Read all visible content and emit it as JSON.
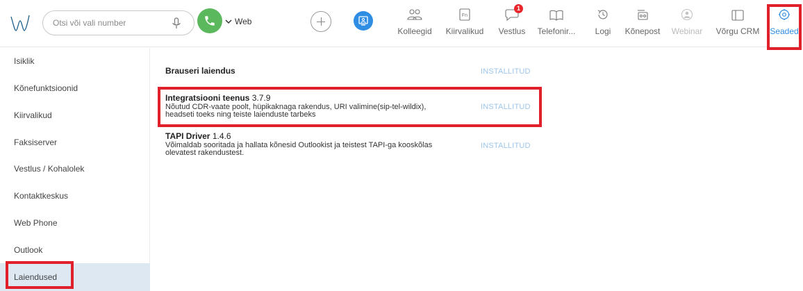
{
  "header": {
    "search_placeholder": "Otsi või vali number",
    "line_label": "Web",
    "nav": [
      {
        "label": "Kolleegid",
        "icon": "colleagues-icon"
      },
      {
        "label": "Kiirvalikud",
        "icon": "fn-key-icon"
      },
      {
        "label": "Vestlus",
        "icon": "chat-icon",
        "badge": "1"
      },
      {
        "label": "Telefonir...",
        "icon": "phonebook-icon"
      },
      {
        "label": "Logi",
        "icon": "history-icon"
      },
      {
        "label": "Kõnepost",
        "icon": "voicemail-icon"
      },
      {
        "label": "Webinar",
        "icon": "webinar-icon",
        "disabled": true
      },
      {
        "label": "Võrgu CRM",
        "icon": "crm-icon"
      },
      {
        "label": "Seaded",
        "icon": "settings-icon",
        "active": true
      }
    ]
  },
  "sidebar": {
    "items": [
      {
        "label": "Isiklik"
      },
      {
        "label": "Kõnefunktsioonid"
      },
      {
        "label": "Kiirvalikud"
      },
      {
        "label": "Faksiserver"
      },
      {
        "label": "Vestlus / Kohalolek"
      },
      {
        "label": "Kontaktkeskus"
      },
      {
        "label": "Web Phone"
      },
      {
        "label": "Outlook"
      },
      {
        "label": "Laiendused",
        "active": true
      }
    ]
  },
  "extensions": [
    {
      "name": "Brauseri laiendus",
      "version": "",
      "description": "",
      "status": "INSTALLITUD"
    },
    {
      "name": "Integratsiooni teenus",
      "version": "3.7.9",
      "description": "Nõutud CDR-vaate poolt, hüpikaknaga rakendus, URI valimine(sip-tel-wildix), headseti toeks ning teiste laienduste tarbeks",
      "status": "INSTALLITUD"
    },
    {
      "name": "TAPI Driver",
      "version": "1.4.6",
      "description": "Võimaldab sooritada ja hallata kõnesid Outlookist ja teistest TAPI-ga kooskõlas olevatest rakendustest.",
      "status": "INSTALLITUD"
    }
  ],
  "colors": {
    "accent": "#2f8de4",
    "call": "#5cb85c",
    "status": "#9dc5ea",
    "highlight": "#e0212b",
    "badge": "#e8262b",
    "sidebar_active": "#dde8f3"
  }
}
